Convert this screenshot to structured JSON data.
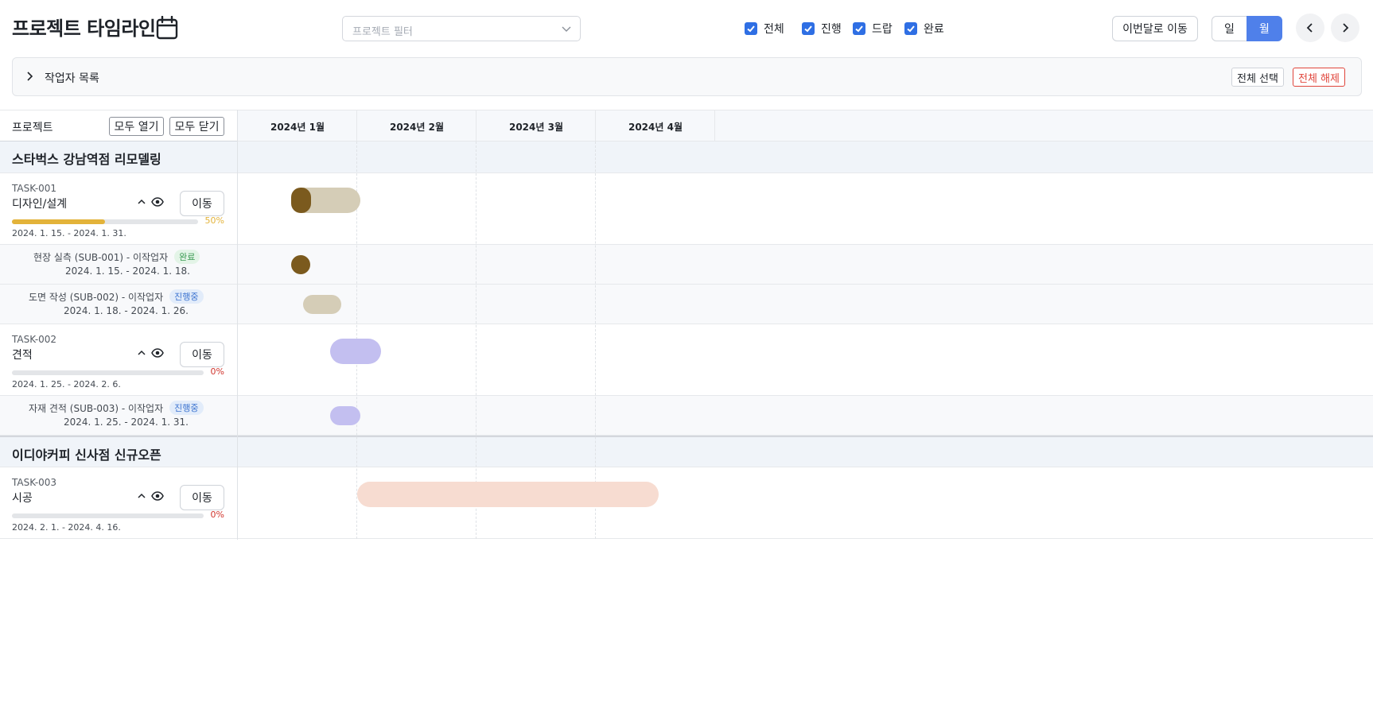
{
  "header": {
    "title": "프로젝트 타임라인",
    "filter_placeholder": "프로젝트 필터",
    "status_filters": [
      {
        "label": "전체",
        "checked": true
      },
      {
        "label": "진행",
        "checked": true
      },
      {
        "label": "드랍",
        "checked": true
      },
      {
        "label": "완료",
        "checked": true
      }
    ],
    "this_month_button": "이번달로 이동",
    "view_toggle": {
      "day": "일",
      "month": "월",
      "selected": "월"
    }
  },
  "workers": {
    "label": "작업자 목록",
    "select_all": "전체 선택",
    "deselect_all": "전체 해제"
  },
  "gantt": {
    "left_header": "프로젝트",
    "expand_all": "모두 열기",
    "collapse_all": "모두 닫기",
    "months": [
      "2024년 1월",
      "2024년 2월",
      "2024년 3월",
      "2024년 4월"
    ]
  },
  "groups": [
    {
      "title": "스타벅스 강남역점 리모델링",
      "tasks": [
        {
          "code": "TASK-001",
          "name": "디자인/설계",
          "move": "이동",
          "progress_text": "50%",
          "progress": 0.5,
          "dates": "2024. 1. 15. - 2024. 1. 31.",
          "color": "#d5cdb7",
          "accent": "#7b5a1e",
          "subs": [
            {
              "label": "현장 실측 (SUB-001) - 이작업자",
              "status": "완료",
              "dates": "2024. 1. 15. - 2024. 1. 18."
            },
            {
              "label": "도면 작성 (SUB-002) - 이작업자",
              "status": "진행중",
              "dates": "2024. 1. 18. - 2024. 1. 26."
            }
          ]
        },
        {
          "code": "TASK-002",
          "name": "견적",
          "move": "이동",
          "progress_text": "0%",
          "progress": 0,
          "dates": "2024. 1. 25. - 2024. 2. 6.",
          "color": "#c3bff0",
          "subs": [
            {
              "label": "자재 견적 (SUB-003) - 이작업자",
              "status": "진행중",
              "dates": "2024. 1. 25. - 2024. 1. 31."
            }
          ]
        }
      ]
    },
    {
      "title": "이디야커피 신사점 신규오픈",
      "tasks": [
        {
          "code": "TASK-003",
          "name": "시공",
          "move": "이동",
          "progress_text": "0%",
          "progress": 0,
          "dates": "2024. 2. 1. - 2024. 4. 16.",
          "color": "#f7dcd1",
          "subs": []
        }
      ]
    }
  ],
  "colors": {
    "primary": "#4f80ea",
    "progress_yellow": "#e3b33a",
    "progress_red": "#d0342c",
    "danger": "#e0453b"
  }
}
